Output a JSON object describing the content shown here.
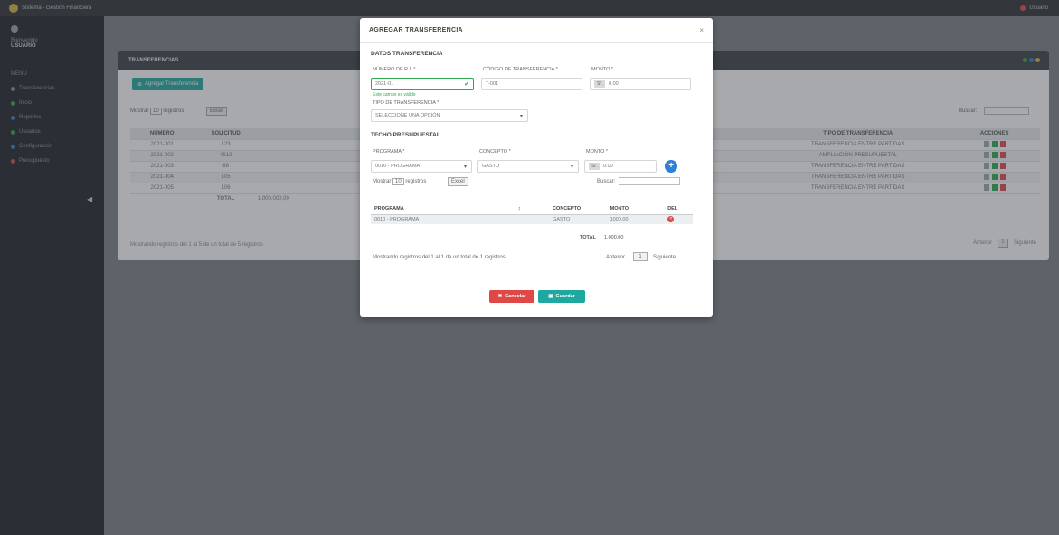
{
  "topbar": {
    "app_title": "Sistema - Gestión Financiera",
    "user_label": "Usuario"
  },
  "sidebar": {
    "user_role": "Bienvenido",
    "user_name": "USUARIO",
    "section_label": "MENÚ",
    "items": [
      {
        "label": "Transferencias",
        "color": "#8d949b"
      },
      {
        "label": "Inicio",
        "color": "#2fa84f"
      },
      {
        "label": "Reportes",
        "color": "#2d7fd8"
      },
      {
        "label": "Usuarios",
        "color": "#2fa84f"
      },
      {
        "label": "Configuración",
        "color": "#2d7fd8"
      },
      {
        "label": "Presupuesto",
        "color": "#e04848"
      }
    ]
  },
  "panel": {
    "title": "TRANSFERENCIAS",
    "add_button": "Agregar Transferencia",
    "show_label": "Mostrar",
    "show_value": "10",
    "entries_label": "registros",
    "excel_label": "Excel",
    "search_label": "Buscar:",
    "headers": [
      "NÚMERO",
      "SOLICITUD",
      "",
      "",
      "",
      "",
      "",
      "TIPO DE TRANSFERENCIA",
      "ACCIONES"
    ],
    "rows": [
      {
        "num": "2021-001",
        "sol": "123",
        "tipo": "TRANSFERENCIA ENTRE PARTIDAS"
      },
      {
        "num": "2021-002",
        "sol": "4512",
        "tipo": "AMPLIACIÓN PRESUPUESTAL"
      },
      {
        "num": "2021-003",
        "sol": "88",
        "tipo": "TRANSFERENCIA ENTRE PARTIDAS"
      },
      {
        "num": "2021-004",
        "sol": "105",
        "tipo": "TRANSFERENCIA ENTRE PARTIDAS"
      },
      {
        "num": "2021-005",
        "sol": "106",
        "tipo": "TRANSFERENCIA ENTRE PARTIDAS"
      }
    ],
    "total_label": "TOTAL",
    "total_value": "1.000.000,00",
    "info": "Mostrando registros del 1 al 5 de un total de 5 registros",
    "prev_label": "Anterior",
    "page": "1",
    "next_label": "Siguiente"
  },
  "modal": {
    "title": "AGREGAR TRANSFERENCIA",
    "close": "×",
    "section_data": "DATOS TRANSFERENCIA",
    "f_num_label": "NÚMERO DE R.I. *",
    "f_num_value": "2021-01",
    "f_num_hint": "Este campo es válido",
    "f_code_label": "CÓDIGO DE TRANSFERENCIA *",
    "f_code_value": "T-001",
    "f_amount_label": "MONTO *",
    "f_amount_prefix": "S/.",
    "f_amount_value": "0.00",
    "f_type_label": "TIPO DE TRANSFERENCIA *",
    "f_type_value": "SELECCIONE UNA OPCIÓN",
    "section_budget": "TECHO PRESUPUESTAL",
    "f_prog_label": "PROGRAMA *",
    "f_prog_value": "0010 - PROGRAMA",
    "f_concept_label": "CONCEPTO *",
    "f_concept_value": "GASTO",
    "f_amount2_label": "MONTO *",
    "f_amount2_prefix": "S/.",
    "f_amount2_value": "0.00",
    "show_label": "Mostrar",
    "show_value": "10",
    "entries_label": "registros",
    "excel_label": "Excel",
    "search_label": "Buscar:",
    "inner_headers": [
      "PROGRAMA",
      "",
      "CONCEPTO",
      "MONTO",
      "DEL"
    ],
    "inner_rows": [
      {
        "prog": "0010 - PROGRAMA",
        "concept": "GASTO",
        "amount": "1000.00"
      }
    ],
    "total_label": "TOTAL",
    "total_value": "1.000,00",
    "info": "Mostrando registros del 1 al 1 de un total de 1 registros",
    "prev_label": "Anterior",
    "page": "1",
    "next_label": "Siguiente",
    "cancel_label": "Cancelar",
    "save_label": "Guardar"
  },
  "colors": {
    "accent_teal": "#1fa8a0",
    "danger": "#e04848",
    "success": "#2fa84f",
    "primary": "#2d7fd8"
  }
}
